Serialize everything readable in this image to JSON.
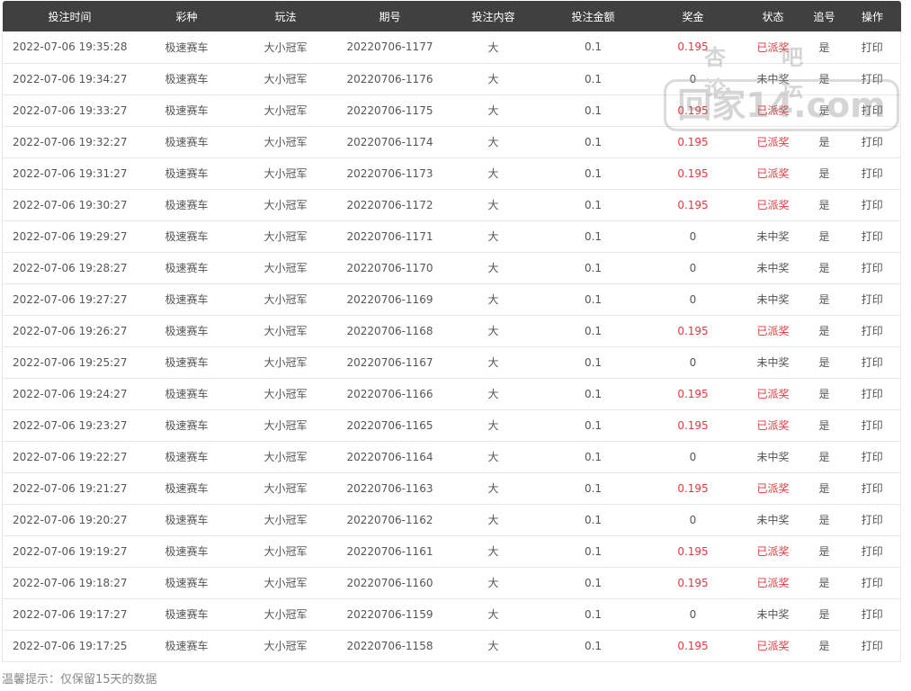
{
  "columns": [
    "投注时间",
    "彩种",
    "玩法",
    "期号",
    "投注内容",
    "投注金额",
    "奖金",
    "状态",
    "追号",
    "操作"
  ],
  "rows": [
    [
      "2022-07-06 19:35:28",
      "极速赛车",
      "大小冠军",
      "20220706-1177",
      "大",
      "0.1",
      "0.195",
      "已派奖",
      "是",
      "打印"
    ],
    [
      "2022-07-06 19:34:27",
      "极速赛车",
      "大小冠军",
      "20220706-1176",
      "大",
      "0.1",
      "0",
      "未中奖",
      "是",
      "打印"
    ],
    [
      "2022-07-06 19:33:27",
      "极速赛车",
      "大小冠军",
      "20220706-1175",
      "大",
      "0.1",
      "0.195",
      "已派奖",
      "是",
      "打印"
    ],
    [
      "2022-07-06 19:32:27",
      "极速赛车",
      "大小冠军",
      "20220706-1174",
      "大",
      "0.1",
      "0.195",
      "已派奖",
      "是",
      "打印"
    ],
    [
      "2022-07-06 19:31:27",
      "极速赛车",
      "大小冠军",
      "20220706-1173",
      "大",
      "0.1",
      "0.195",
      "已派奖",
      "是",
      "打印"
    ],
    [
      "2022-07-06 19:30:27",
      "极速赛车",
      "大小冠军",
      "20220706-1172",
      "大",
      "0.1",
      "0.195",
      "已派奖",
      "是",
      "打印"
    ],
    [
      "2022-07-06 19:29:27",
      "极速赛车",
      "大小冠军",
      "20220706-1171",
      "大",
      "0.1",
      "0",
      "未中奖",
      "是",
      "打印"
    ],
    [
      "2022-07-06 19:28:27",
      "极速赛车",
      "大小冠军",
      "20220706-1170",
      "大",
      "0.1",
      "0",
      "未中奖",
      "是",
      "打印"
    ],
    [
      "2022-07-06 19:27:27",
      "极速赛车",
      "大小冠军",
      "20220706-1169",
      "大",
      "0.1",
      "0",
      "未中奖",
      "是",
      "打印"
    ],
    [
      "2022-07-06 19:26:27",
      "极速赛车",
      "大小冠军",
      "20220706-1168",
      "大",
      "0.1",
      "0.195",
      "已派奖",
      "是",
      "打印"
    ],
    [
      "2022-07-06 19:25:27",
      "极速赛车",
      "大小冠军",
      "20220706-1167",
      "大",
      "0.1",
      "0",
      "未中奖",
      "是",
      "打印"
    ],
    [
      "2022-07-06 19:24:27",
      "极速赛车",
      "大小冠军",
      "20220706-1166",
      "大",
      "0.1",
      "0.195",
      "已派奖",
      "是",
      "打印"
    ],
    [
      "2022-07-06 19:23:27",
      "极速赛车",
      "大小冠军",
      "20220706-1165",
      "大",
      "0.1",
      "0.195",
      "已派奖",
      "是",
      "打印"
    ],
    [
      "2022-07-06 19:22:27",
      "极速赛车",
      "大小冠军",
      "20220706-1164",
      "大",
      "0.1",
      "0",
      "未中奖",
      "是",
      "打印"
    ],
    [
      "2022-07-06 19:21:27",
      "极速赛车",
      "大小冠军",
      "20220706-1163",
      "大",
      "0.1",
      "0.195",
      "已派奖",
      "是",
      "打印"
    ],
    [
      "2022-07-06 19:20:27",
      "极速赛车",
      "大小冠军",
      "20220706-1162",
      "大",
      "0.1",
      "0",
      "未中奖",
      "是",
      "打印"
    ],
    [
      "2022-07-06 19:19:27",
      "极速赛车",
      "大小冠军",
      "20220706-1161",
      "大",
      "0.1",
      "0.195",
      "已派奖",
      "是",
      "打印"
    ],
    [
      "2022-07-06 19:18:27",
      "极速赛车",
      "大小冠军",
      "20220706-1160",
      "大",
      "0.1",
      "0.195",
      "已派奖",
      "是",
      "打印"
    ],
    [
      "2022-07-06 19:17:27",
      "极速赛车",
      "大小冠军",
      "20220706-1159",
      "大",
      "0.1",
      "0",
      "未中奖",
      "是",
      "打印"
    ],
    [
      "2022-07-06 19:17:25",
      "极速赛车",
      "大小冠军",
      "20220706-1158",
      "大",
      "0.1",
      "0.195",
      "已派奖",
      "是",
      "打印"
    ]
  ],
  "note": "温馨提示：仅保留15天的数据",
  "watermark": {
    "top": "杏吧论坛",
    "main": "回家14.com"
  },
  "colors": {
    "header_bg": "#404040",
    "win": "#e0393e",
    "text": "#555555"
  }
}
